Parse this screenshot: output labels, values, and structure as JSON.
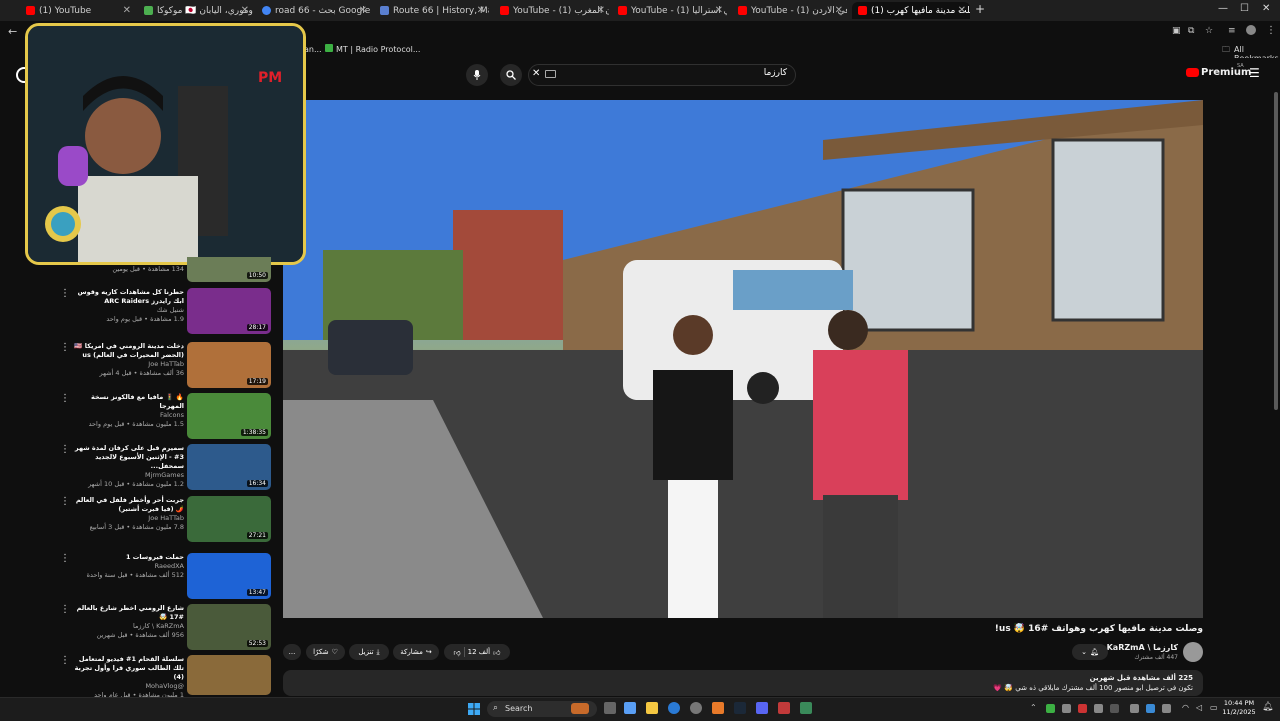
{
  "browser": {
    "tabs": [
      {
        "title": "(1) YouTube",
        "color": "#ff0000"
      },
      {
        "title": "موكوكا 🇯🇵 إلى أوموري، اليابان",
        "color": "#4caf50"
      },
      {
        "title": "road 66 - بحث Google",
        "color": "#4285f4"
      },
      {
        "title": "Route 66 | History, Map, Popula...",
        "color": "#5a7fd0"
      },
      {
        "title": "YouTube - (1) كرفان المغرب",
        "color": "#ff0000"
      },
      {
        "title": "YouTube - (1) كرفان في استراليا",
        "color": "#ff0000"
      },
      {
        "title": "YouTube - (1) كرفان في الاردن",
        "color": "#ff0000"
      },
      {
        "title": "(1) وصلت مدينة مافيها كهرب...",
        "color": "#ff0000"
      }
    ],
    "new_tab": "+",
    "bookmarks": [
      {
        "label": "an..."
      },
      {
        "label": "MT | Radio Protocol..."
      }
    ],
    "all_bookmarks": "All Bookmarks",
    "window_controls": [
      "—",
      "☐",
      "✕"
    ]
  },
  "youtube": {
    "premium_label": "Premium",
    "premium_region": "SA",
    "search_query": "كارزما",
    "search_clear": "✕"
  },
  "video": {
    "title": "وصلت مدينة مافيها كهرب وهواتف #16 🤯 us!",
    "channel_name": "KaRZmA \\ كارزما",
    "subscribers": "447 ألف مشترك",
    "likes": "12 ألف",
    "share_label": "مشاركة",
    "download_label": "تنزيل",
    "thanks_label": "شكرًا",
    "more_label": "...",
    "views_line": "225 ألف مشاهدة  قبل شهرين",
    "desc_line": "تكون في ترصيل ابو منصور 100 ألف مشترك مايلاقي ذه شي 🤯 💗"
  },
  "sidebar": {
    "items": [
      {
        "title": "",
        "channel": "",
        "views": "134 مشاهدة • قبل يومين",
        "duration": "10:50",
        "thumb": "#6b7d57"
      },
      {
        "title": "حطرنا كل مشاهدات كاريه وقوس ابك رايدرز ARC Raiders",
        "channel": "شنيل شك",
        "views": "1.9 مشاهدة • قبل يوم واحد",
        "duration": "28:17",
        "thumb": "#7a2d8c"
      },
      {
        "title": "دخلت مدينة الرومني في امريكا 🇺🇸 (الحضر المحيرات في العالم) us",
        "channel": "Joe HaTTab",
        "views": "36 ألف مشاهدة • قبل 4 أشهر",
        "duration": "17:19",
        "thumb": "#b0703a"
      },
      {
        "title": "🔥 🚦 مافيا مع فالكونز نسخة المهرجا",
        "channel": "Falcons",
        "views": "1.5 مليون مشاهدة • قبل يوم واحد",
        "duration": "1:38:35",
        "thumb": "#4a8a3a"
      },
      {
        "title": "سميرم قبل على كرفان لمدة شهر 3# - الإثنين الأسبوع لالجديد سمحفل...",
        "channel": "MjrmGames",
        "views": "1.2 مليون مشاهدة • قبل 10 أشهر",
        "duration": "16:34",
        "thumb": "#2d5a8c"
      },
      {
        "title": "جربت أحر وأخطر فلفل في العالم 🌶️ (فيا فبرت أشتبر)",
        "channel": "Joe HaTTab",
        "views": "7.8 مليون مشاهدة • قبل 3 أسابيع",
        "duration": "27:21",
        "thumb": "#3a6a3a"
      },
      {
        "title": "حملت فيروسات 1",
        "channel": "RaeedXA",
        "views": "512 ألف مشاهدة • قبل سنة واحدة",
        "duration": "13:47",
        "thumb": "#1e63d6"
      },
      {
        "title": "شارع الرومني اخطر شارع بالعالم #17 🤯",
        "channel": "KaRZmA \\ كارزما",
        "views": "956 ألف مشاهدة • قبل شهرين",
        "duration": "52:53",
        "thumb": "#4a5a3a"
      },
      {
        "title": "سلسلة القحام 1# فيديو لمتعامل تلك الطالب سوري قرا وأول تجربة (4)",
        "channel": "@MohaVlog",
        "views": "1 مليون مشاهدة • قبل عام واحد",
        "duration": "",
        "thumb": "#8a6a3a"
      }
    ]
  },
  "taskbar": {
    "search_label": "Search",
    "time": "10:44 PM",
    "date": "11/2/2025"
  }
}
